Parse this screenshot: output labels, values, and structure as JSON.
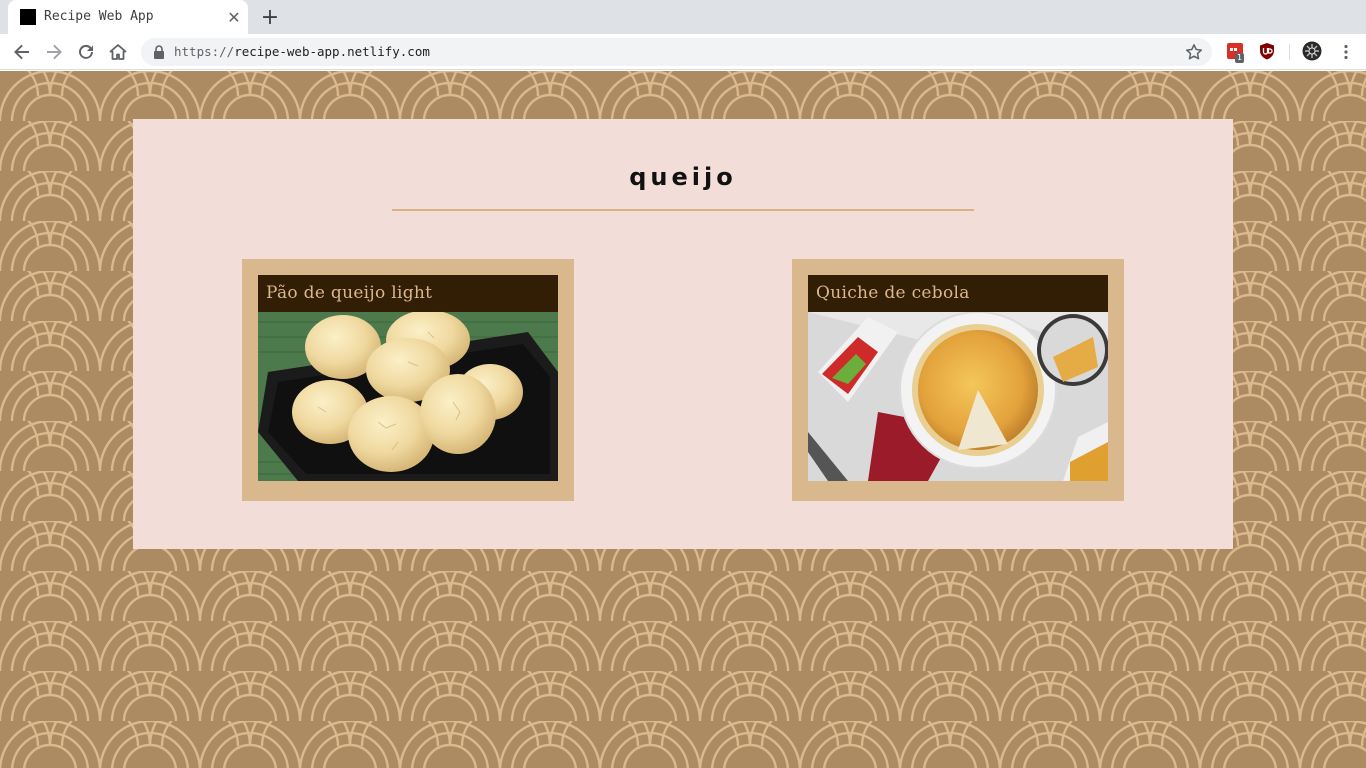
{
  "browser": {
    "tab_title": "Recipe Web App",
    "tab_close_glyph": "✕",
    "new_tab_glyph": "+",
    "url_scheme": "https://",
    "url_host": "recipe-web-app.netlify.com",
    "extension_badge_count": "1",
    "icons": [
      "back-icon",
      "forward-icon",
      "reload-icon",
      "home-icon",
      "lock-icon",
      "star-icon",
      "extension-icon",
      "ublock-icon",
      "profile-icon",
      "menu-icon"
    ]
  },
  "page": {
    "title": "queijo",
    "colors": {
      "background": "#ac8a62",
      "pattern": "#dcb98c",
      "panel": "#f2ddd8",
      "card": "#dab88d",
      "card_header": "#321d05"
    },
    "recipes": [
      {
        "title": "Pão de queijo light",
        "image": "cheese-bread-photo"
      },
      {
        "title": "Quiche de cebola",
        "image": "onion-quiche-photo"
      }
    ]
  }
}
